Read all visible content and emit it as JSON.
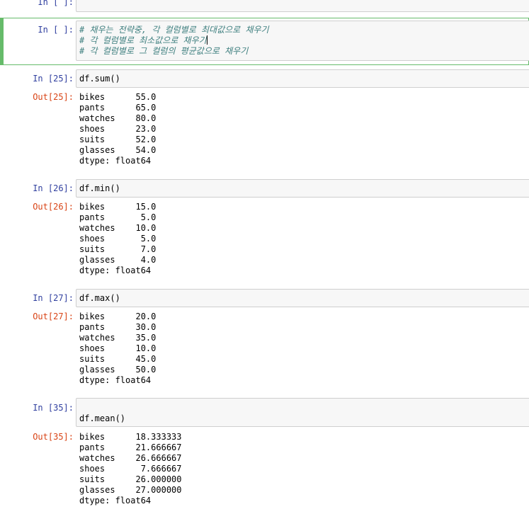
{
  "cells": [
    {
      "prompt": "In [ ]:",
      "code": ""
    },
    {
      "prompt": "In [ ]:",
      "code_lines": [
        "# 채우는 전략중, 각 컬럼별로 최대값으로 채우기",
        "# 각 컬럼별로 최소값으로 채우기",
        "# 각 컬럼별로 그 컬럼의 평균값으로 채우기"
      ]
    },
    {
      "prompt": "In [25]:",
      "code": "df.sum()",
      "out_prompt": "Out[25]:",
      "output": "bikes      55.0\npants      65.0\nwatches    80.0\nshoes      23.0\nsuits      52.0\nglasses    54.0\ndtype: float64"
    },
    {
      "prompt": "In [26]:",
      "code": "df.min()",
      "out_prompt": "Out[26]:",
      "output": "bikes      15.0\npants       5.0\nwatches    10.0\nshoes       5.0\nsuits       7.0\nglasses     4.0\ndtype: float64"
    },
    {
      "prompt": "In [27]:",
      "code": "df.max()",
      "out_prompt": "Out[27]:",
      "output": "bikes      20.0\npants      30.0\nwatches    35.0\nshoes      10.0\nsuits      45.0\nglasses    50.0\ndtype: float64"
    },
    {
      "prompt": "In [35]:",
      "code": "df.mean()",
      "out_prompt": "Out[35]:",
      "output": "bikes      18.333333\npants      21.666667\nwatches    26.666667\nshoes       7.666667\nsuits      26.000000\nglasses    27.000000\ndtype: float64"
    }
  ]
}
